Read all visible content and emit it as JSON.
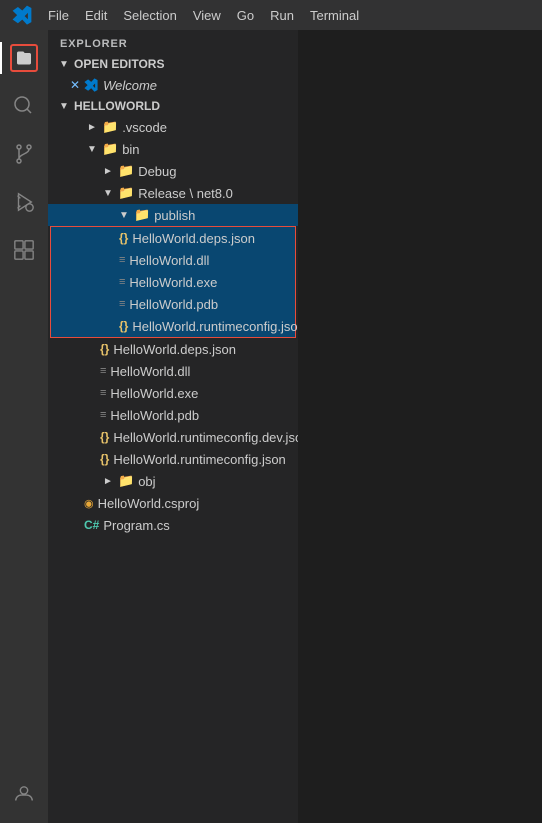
{
  "menubar": {
    "items": [
      "File",
      "Edit",
      "Selection",
      "View",
      "Go",
      "Run",
      "Terminal"
    ]
  },
  "activity": {
    "icons": [
      {
        "name": "explorer",
        "label": "Explorer",
        "active": true
      },
      {
        "name": "search",
        "label": "Search",
        "active": false
      },
      {
        "name": "source-control",
        "label": "Source Control",
        "active": false
      },
      {
        "name": "run",
        "label": "Run and Debug",
        "active": false
      },
      {
        "name": "extensions",
        "label": "Extensions",
        "active": false
      },
      {
        "name": "accounts",
        "label": "Accounts",
        "active": false
      }
    ]
  },
  "explorer": {
    "title": "EXPLORER",
    "sections": {
      "open_editors": {
        "label": "OPEN EDITORS",
        "items": [
          {
            "name": "Welcome",
            "icon": "vscode"
          }
        ]
      },
      "helloworld": {
        "label": "HELLOWORLD",
        "tree": [
          {
            "indent": 1,
            "type": "folder",
            "name": ".vscode",
            "chevron": "►"
          },
          {
            "indent": 1,
            "type": "folder",
            "name": "bin",
            "chevron": "▼"
          },
          {
            "indent": 2,
            "type": "folder",
            "name": "Debug",
            "chevron": "►"
          },
          {
            "indent": 2,
            "type": "folder",
            "name": "Release \\ net8.0",
            "chevron": "▼"
          },
          {
            "indent": 3,
            "type": "folder",
            "name": "publish",
            "chevron": "▼",
            "selected": true
          },
          {
            "indent": 4,
            "type": "json",
            "name": "HelloWorld.deps.json",
            "in_publish": true
          },
          {
            "indent": 4,
            "type": "bin",
            "name": "HelloWorld.dll",
            "in_publish": true
          },
          {
            "indent": 4,
            "type": "bin",
            "name": "HelloWorld.exe",
            "in_publish": true
          },
          {
            "indent": 4,
            "type": "bin",
            "name": "HelloWorld.pdb",
            "in_publish": true
          },
          {
            "indent": 4,
            "type": "json",
            "name": "HelloWorld.runtimeconfig.json",
            "in_publish": true
          },
          {
            "indent": 3,
            "type": "json",
            "name": "HelloWorld.deps.json"
          },
          {
            "indent": 3,
            "type": "bin",
            "name": "HelloWorld.dll"
          },
          {
            "indent": 3,
            "type": "bin",
            "name": "HelloWorld.exe"
          },
          {
            "indent": 3,
            "type": "bin",
            "name": "HelloWorld.pdb"
          },
          {
            "indent": 3,
            "type": "json",
            "name": "HelloWorld.runtimeconfig.dev.json"
          },
          {
            "indent": 3,
            "type": "json",
            "name": "HelloWorld.runtimeconfig.json"
          },
          {
            "indent": 2,
            "type": "folder",
            "name": "obj",
            "chevron": "►"
          },
          {
            "indent": 1,
            "type": "csproj",
            "name": "HelloWorld.csproj"
          },
          {
            "indent": 1,
            "type": "cs",
            "name": "Program.cs"
          }
        ]
      }
    }
  }
}
